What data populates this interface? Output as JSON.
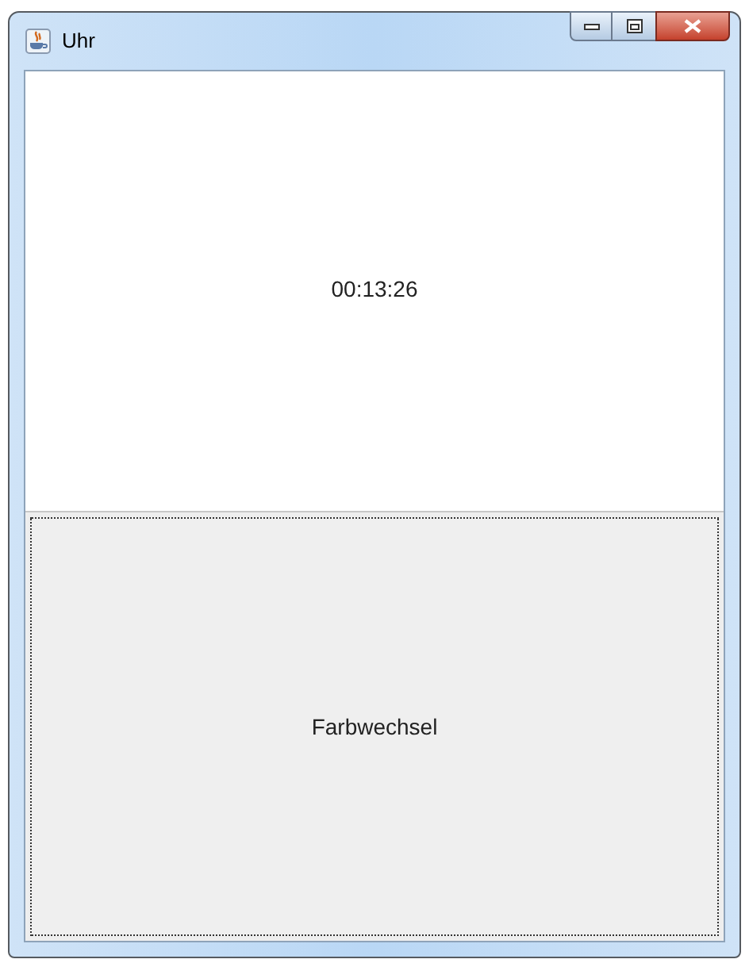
{
  "window": {
    "title": "Uhr"
  },
  "clock": {
    "time": "00:13:26"
  },
  "button": {
    "label": "Farbwechsel",
    "focused": true
  }
}
